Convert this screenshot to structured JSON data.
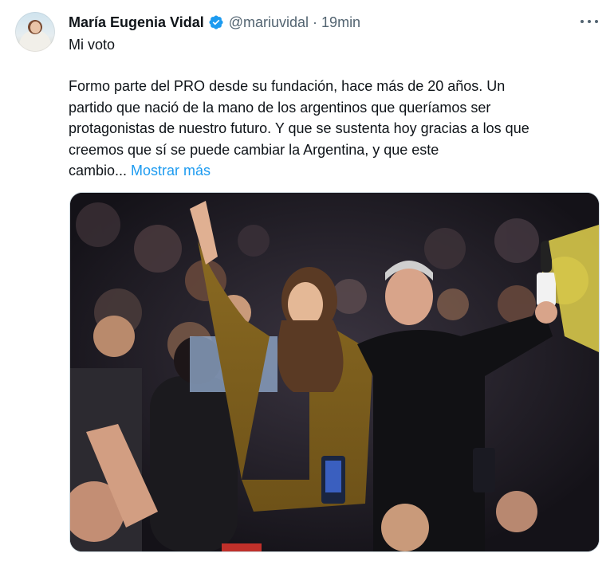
{
  "author": {
    "name": "María Eugenia Vidal",
    "handle": "@mariuvidal",
    "time": "19min",
    "separator": "·",
    "verified_color": "#1d9bf0"
  },
  "tweet": {
    "first_line": "Mi voto",
    "body_lines": [
      "Formo parte del PRO desde su fundación, hace más de 20 años. Un",
      "partido que nació de la mano de los argentinos que queríamos ser",
      "protagonistas de nuestro futuro. Y que se sustenta hoy gracias a los que",
      "creemos que sí se puede cambiar la Argentina, y que este"
    ],
    "last_line_prefix": "cambio...",
    "show_more": "Mostrar más"
  },
  "colors": {
    "link": "#1d9bf0",
    "secondary_text": "#536471",
    "border": "#cfd9de"
  },
  "icons": {
    "more": "more-dots-icon",
    "verified": "verified-badge-icon"
  }
}
